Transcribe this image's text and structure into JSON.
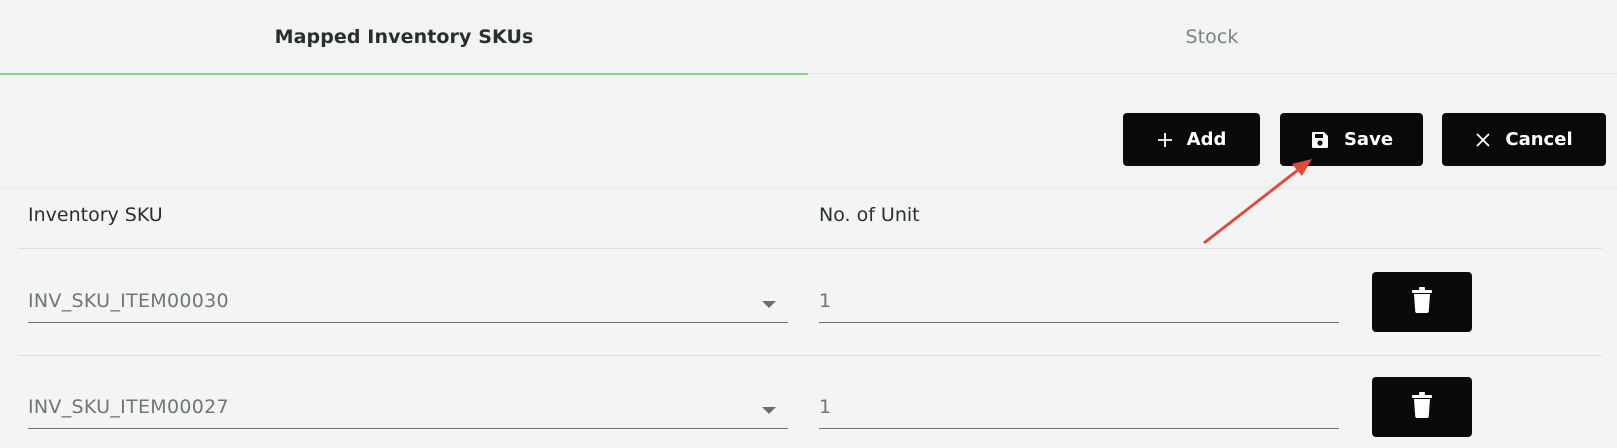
{
  "tabs": [
    {
      "label": "Mapped Inventory SKUs",
      "active": true
    },
    {
      "label": "Stock",
      "active": false
    }
  ],
  "toolbar": {
    "add_label": "Add",
    "save_label": "Save",
    "cancel_label": "Cancel"
  },
  "table": {
    "headers": {
      "sku": "Inventory SKU",
      "units": "No. of Unit"
    },
    "rows": [
      {
        "sku": "INV_SKU_ITEM00030",
        "units": "1"
      },
      {
        "sku": "INV_SKU_ITEM00027",
        "units": "1"
      }
    ]
  },
  "icons": {
    "add": "plus-icon",
    "save": "floppy-disk-icon",
    "cancel": "close-icon",
    "delete": "trash-icon",
    "dropdown": "caret-down-icon"
  },
  "colors": {
    "background": "#f1f4f3",
    "button": "#0a0a0a",
    "active_tab_indicator": "#8ed67a",
    "annotation_arrow": "#e04a3a"
  }
}
